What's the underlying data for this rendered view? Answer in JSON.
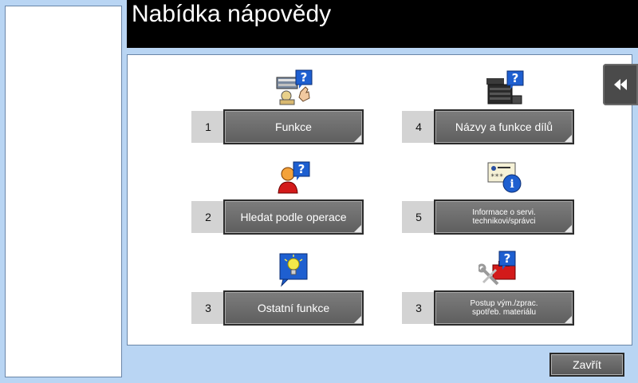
{
  "header": {
    "title": "Nabídka nápovědy"
  },
  "menu": [
    {
      "number": "1",
      "label": "Funkce",
      "icon": "functions-help-icon"
    },
    {
      "number": "2",
      "label": "Hledat podle operace",
      "icon": "search-by-operation-help-icon"
    },
    {
      "number": "3",
      "label": "Ostatní funkce",
      "icon": "lightbulb-icon"
    },
    {
      "number": "4",
      "label": "Názvy a funkce dílů",
      "icon": "machine-parts-help-icon"
    },
    {
      "number": "5",
      "label_line1": "Informace o servi.",
      "label_line2": "technikovi/správci",
      "icon": "admin-info-icon"
    },
    {
      "number": "3",
      "label_line1": "Postup vým./zprac.",
      "label_line2": "spotřeb. materiálu",
      "icon": "consumables-toolbox-icon"
    }
  ],
  "footer": {
    "close_label": "Zavřít"
  },
  "side_tab": {
    "icon": "double-chevron-left-icon"
  }
}
